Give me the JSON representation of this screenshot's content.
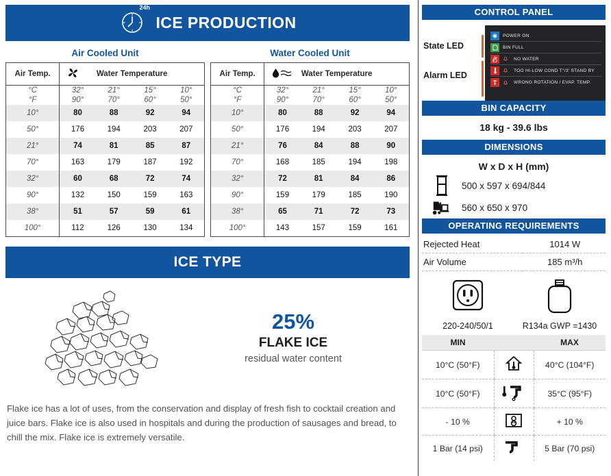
{
  "left": {
    "main_banner": {
      "title": "ICE PRODUCTION",
      "badge": "24h",
      "icon": "clock-24h-icon"
    },
    "air_unit": {
      "title": "Air Cooled Unit",
      "icon": "fan-icon",
      "col_header_air": "Air Temp.",
      "col_header_water": "Water Temperature",
      "unit_c": "°C",
      "unit_f": "°F",
      "water_temps_c": [
        "32°",
        "21°",
        "15°",
        "10°"
      ],
      "water_temps_f": [
        "90°",
        "70°",
        "60°",
        "50°"
      ],
      "rows": [
        {
          "air": "10°",
          "unit": "C",
          "values": [
            "80",
            "88",
            "92",
            "94"
          ]
        },
        {
          "air": "50°",
          "unit": "F",
          "values": [
            "176",
            "194",
            "203",
            "207"
          ]
        },
        {
          "air": "21°",
          "unit": "C",
          "values": [
            "74",
            "81",
            "85",
            "87"
          ]
        },
        {
          "air": "70°",
          "unit": "F",
          "values": [
            "163",
            "179",
            "187",
            "192"
          ]
        },
        {
          "air": "32°",
          "unit": "C",
          "values": [
            "60",
            "68",
            "72",
            "74"
          ]
        },
        {
          "air": "90°",
          "unit": "F",
          "values": [
            "132",
            "150",
            "159",
            "163"
          ]
        },
        {
          "air": "38°",
          "unit": "C",
          "values": [
            "51",
            "57",
            "59",
            "61"
          ]
        },
        {
          "air": "100°",
          "unit": "F",
          "values": [
            "112",
            "126",
            "130",
            "134"
          ]
        }
      ]
    },
    "water_unit": {
      "title": "Water Cooled Unit",
      "icon": "water-drop-icon",
      "col_header_air": "Air Temp.",
      "col_header_water": "Water Temperature",
      "unit_c": "°C",
      "unit_f": "°F",
      "water_temps_c": [
        "32°",
        "21°",
        "15°",
        "10°"
      ],
      "water_temps_f": [
        "90°",
        "70°",
        "60°",
        "50°"
      ],
      "rows": [
        {
          "air": "10°",
          "unit": "C",
          "values": [
            "80",
            "88",
            "92",
            "94"
          ]
        },
        {
          "air": "50°",
          "unit": "F",
          "values": [
            "176",
            "194",
            "203",
            "207"
          ]
        },
        {
          "air": "21°",
          "unit": "C",
          "values": [
            "76",
            "84",
            "88",
            "90"
          ]
        },
        {
          "air": "70°",
          "unit": "F",
          "values": [
            "168",
            "185",
            "194",
            "198"
          ]
        },
        {
          "air": "32°",
          "unit": "C",
          "values": [
            "72",
            "81",
            "84",
            "86"
          ]
        },
        {
          "air": "90°",
          "unit": "F",
          "values": [
            "159",
            "179",
            "185",
            "190"
          ]
        },
        {
          "air": "38°",
          "unit": "C",
          "values": [
            "65",
            "71",
            "72",
            "73"
          ]
        },
        {
          "air": "100°",
          "unit": "F",
          "values": [
            "143",
            "157",
            "159",
            "161"
          ]
        }
      ]
    },
    "ice_type": {
      "banner": "ICE TYPE",
      "percent": "25%",
      "name": "FLAKE ICE",
      "subtitle": "residual water content",
      "image_icon": "flake-ice-pile-illustration",
      "description": "Flake ice has a lot of uses, from the conservation and display of fresh fish to cocktail creation and juice bars. Flake ice is also used in hospitals and during the production of sausages and bread, to chill the mix. Flake ice is extremely versatile."
    }
  },
  "right": {
    "control_panel": {
      "banner": "CONTROL PANEL",
      "state_label": "State LED",
      "alarm_label": "Alarm LED",
      "leds": [
        {
          "text": "POWER ON",
          "color": "#1779c4",
          "icon": "snowflake-icon",
          "bell": false
        },
        {
          "text": "BIN FULL",
          "color": "#3f9a45",
          "icon": "bin-icon",
          "bell": false
        },
        {
          "text": "NO WATER",
          "color": "#d32a26",
          "icon": "no-water-icon",
          "bell": true
        },
        {
          "text": "TOO HI-LOW COND T°/3' STAND BY",
          "color": "#d32a26",
          "icon": "thermometer-icon",
          "bell": true
        },
        {
          "text": "WRONG ROTATION / EVAP. TEMP.",
          "color": "#d32a26",
          "icon": "rotation-icon",
          "bell": true
        }
      ]
    },
    "bin_capacity": {
      "banner": "BIN CAPACITY",
      "value": "18 kg  - 39.6 lbs"
    },
    "dimensions": {
      "banner": "DIMENSIONS",
      "unit_label": "W x D x H (mm)",
      "rows": [
        {
          "icon": "machine-cabinet-icon",
          "value": "500 x 597 x 694/844"
        },
        {
          "icon": "forklift-pallet-icon",
          "value": "560 x 650 x 970"
        }
      ]
    },
    "operating_requirements": {
      "banner": "OPERATING REQUIREMENTS",
      "rows": [
        {
          "label": "Rejected Heat",
          "value": "1014 W"
        },
        {
          "label": "Air Volume",
          "value": "185 m³/h"
        }
      ],
      "power": [
        {
          "icon": "power-socket-icon",
          "caption": "220-240/50/1"
        },
        {
          "icon": "refrigerant-bottle-icon",
          "caption": "R134a GWP =1430"
        }
      ]
    },
    "minmax": {
      "min_header": "MIN",
      "max_header": "MAX",
      "rows": [
        {
          "icon": "house-thermometer-icon",
          "min": "10°C (50°F)",
          "max": "40°C (104°F)"
        },
        {
          "icon": "water-thermometer-tap-icon",
          "min": "10°C (50°F)",
          "max": "35°C (95°F)"
        },
        {
          "icon": "voltage-variation-icon",
          "min": "- 10 %",
          "max": "+ 10 %"
        },
        {
          "icon": "water-tap-pressure-icon",
          "min": "1 Bar (14 psi)",
          "max": "5 Bar (70 psi)"
        }
      ]
    }
  },
  "colors": {
    "brand_blue": "#11559f",
    "accent_orange": "#d4622a",
    "panel_dark": "#222427"
  }
}
